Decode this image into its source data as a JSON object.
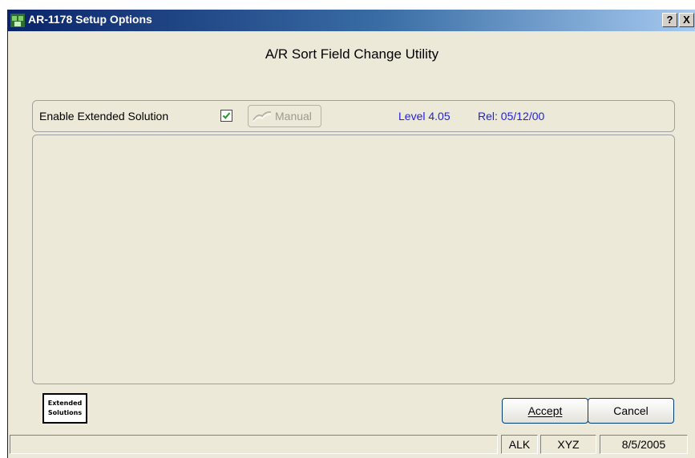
{
  "window": {
    "title": "AR-1178 Setup Options",
    "help_label": "?",
    "close_label": "X"
  },
  "heading": "A/R Sort Field Change Utility",
  "options": {
    "enable_label": "Enable Extended Solution",
    "enable_checked": true,
    "manual_label": "Manual",
    "level": "Level 4.05",
    "release": "Rel: 05/12/00"
  },
  "logo": {
    "line1": "Extended",
    "line2": "Solutions"
  },
  "buttons": {
    "accept": "Accept",
    "cancel": "Cancel"
  },
  "statusbar": {
    "message": "",
    "company": "ALK",
    "user": "XYZ",
    "date": "8/5/2005"
  },
  "colors": {
    "title_gradient_start": "#0a246a",
    "info_text": "#1f1fe0",
    "check_mark": "#1f9b1f"
  }
}
